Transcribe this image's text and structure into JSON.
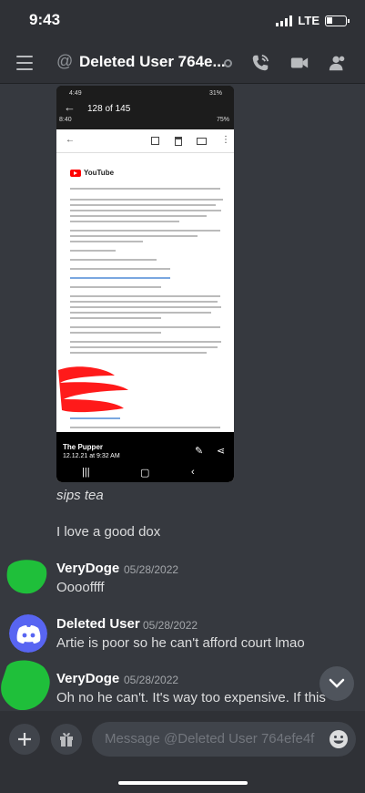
{
  "status_bar": {
    "time": "9:43",
    "network": "LTE"
  },
  "header": {
    "title": "Deleted User 764e...",
    "prefix": "@"
  },
  "embed": {
    "counter": "128 of 145",
    "phone_time": "4:49",
    "phone_battery": "31%",
    "phone_time2": "8:40",
    "phone_battery2": "75%",
    "brand": "YouTube",
    "footer_title": "The Pupper",
    "footer_date": "12.12.21 at 9:32 AM"
  },
  "messages": [
    {
      "text": "sips tea"
    },
    {
      "text": "I love a good dox"
    },
    {
      "author": "VeryDoge",
      "timestamp": "05/28/2022",
      "text": "Ooooffff"
    },
    {
      "author": "Deleted User",
      "timestamp": "05/28/2022",
      "text": "Artie is poor so he can't afford court lmao"
    },
    {
      "author": "VeryDoge",
      "timestamp": "05/28/2022",
      "text": "Oh no he can't. It's way too expensive. If this"
    }
  ],
  "composer": {
    "placeholder": "Message @Deleted User 764efe4f"
  },
  "colors": {
    "background": "#36393f",
    "header": "#2f3136",
    "avatar_green": "#1fbf3a",
    "discord_blurple": "#5865f2"
  }
}
